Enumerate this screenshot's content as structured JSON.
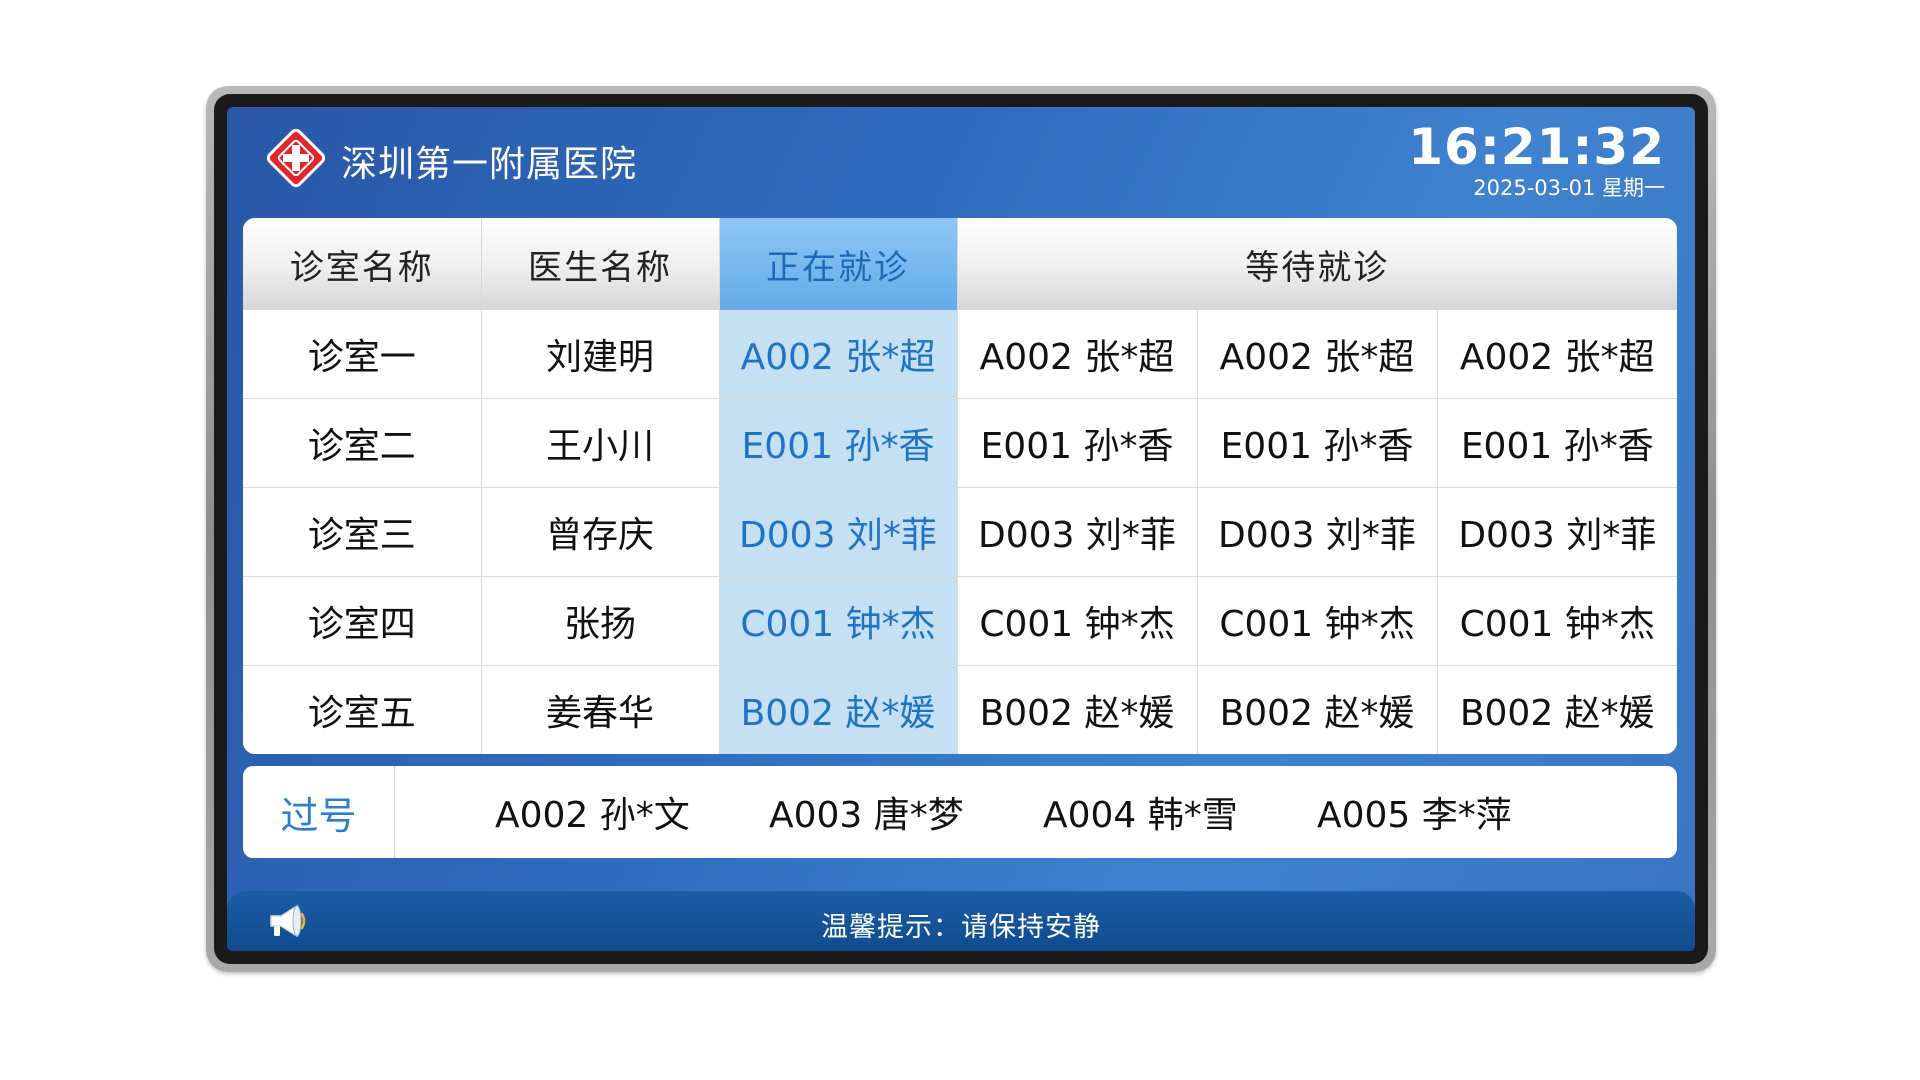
{
  "header": {
    "hospital_name": "深圳第一附属医院",
    "time": "16:21:32",
    "date": "2025-03-01 星期一"
  },
  "table": {
    "headers": {
      "room": "诊室名称",
      "doctor": "医生名称",
      "current": "正在就诊",
      "waiting": "等待就诊"
    },
    "rows": [
      {
        "room": "诊室一",
        "doctor": "刘建明",
        "current": "A002 张*超",
        "waiting": [
          "A002 张*超",
          "A002 张*超",
          "A002 张*超"
        ]
      },
      {
        "room": "诊室二",
        "doctor": "王小川",
        "current": "E001 孙*香",
        "waiting": [
          "E001 孙*香",
          "E001 孙*香",
          "E001 孙*香"
        ]
      },
      {
        "room": "诊室三",
        "doctor": "曾存庆",
        "current": "D003 刘*菲",
        "waiting": [
          "D003 刘*菲",
          "D003 刘*菲",
          "D003 刘*菲"
        ]
      },
      {
        "room": "诊室四",
        "doctor": "张扬",
        "current": "C001 钟*杰",
        "waiting": [
          "C001 钟*杰",
          "C001 钟*杰",
          "C001 钟*杰"
        ]
      },
      {
        "room": "诊室五",
        "doctor": "姜春华",
        "current": "B002 赵*媛",
        "waiting": [
          "B002 赵*媛",
          "B002 赵*媛",
          "B002 赵*媛"
        ]
      }
    ]
  },
  "passed": {
    "label": "过号",
    "items": [
      "A002 孙*文",
      "A003 唐*梦",
      "A004 韩*雪",
      "A005 李*萍"
    ]
  },
  "footer": {
    "notice": "温馨提示：请保持安静"
  },
  "icons": {
    "logo": "red-cross-logo-icon",
    "speaker": "megaphone-icon"
  },
  "colors": {
    "accent": "#2a7fd0",
    "current_column": "#c5dff3",
    "logo_red": "#e0262b"
  }
}
